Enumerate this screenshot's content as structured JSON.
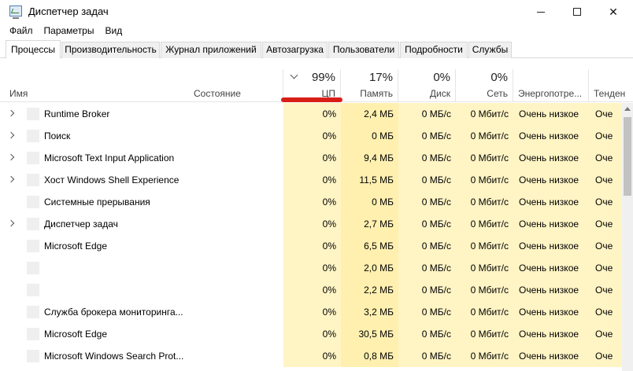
{
  "window": {
    "title": "Диспетчер задач",
    "minimize_label": "",
    "maximize_label": "",
    "close_label": "✕"
  },
  "menu": [
    "Файл",
    "Параметры",
    "Вид"
  ],
  "tabs": [
    {
      "label": "Процессы",
      "active": true
    },
    {
      "label": "Производительность"
    },
    {
      "label": "Журнал приложений"
    },
    {
      "label": "Автозагрузка"
    },
    {
      "label": "Пользователи"
    },
    {
      "label": "Подробности"
    },
    {
      "label": "Службы"
    }
  ],
  "columns": {
    "name": "Имя",
    "status": "Состояние",
    "cpu": {
      "label": "ЦП",
      "percent": "99%"
    },
    "memory": {
      "label": "Память",
      "percent": "17%"
    },
    "disk": {
      "label": "Диск",
      "percent": "0%"
    },
    "network": {
      "label": "Сеть",
      "percent": "0%"
    },
    "energy": "Энергопотре...",
    "trend": "Тенден"
  },
  "rows": [
    {
      "name": "Runtime Broker",
      "expandable": true,
      "cpu": "0%",
      "mem": "2,4 МБ",
      "disk": "0 МБ/с",
      "net": "0 Мбит/с",
      "energy": "Очень низкое",
      "trend": "Оче"
    },
    {
      "name": "Поиск",
      "expandable": true,
      "cpu": "0%",
      "mem": "0 МБ",
      "disk": "0 МБ/с",
      "net": "0 Мбит/с",
      "energy": "Очень низкое",
      "trend": "Оче"
    },
    {
      "name": "Microsoft Text Input Application",
      "expandable": true,
      "cpu": "0%",
      "mem": "9,4 МБ",
      "disk": "0 МБ/с",
      "net": "0 Мбит/с",
      "energy": "Очень низкое",
      "trend": "Оче"
    },
    {
      "name": "Хост Windows Shell Experience",
      "expandable": true,
      "cpu": "0%",
      "mem": "11,5 МБ",
      "disk": "0 МБ/с",
      "net": "0 Мбит/с",
      "energy": "Очень низкое",
      "trend": "Оче"
    },
    {
      "name": "Системные прерывания",
      "expandable": false,
      "cpu": "0%",
      "mem": "0 МБ",
      "disk": "0 МБ/с",
      "net": "0 Мбит/с",
      "energy": "Очень низкое",
      "trend": "Оче"
    },
    {
      "name": "Диспетчер задач",
      "expandable": true,
      "cpu": "0%",
      "mem": "2,7 МБ",
      "disk": "0 МБ/с",
      "net": "0 Мбит/с",
      "energy": "Очень низкое",
      "trend": "Оче"
    },
    {
      "name": "Microsoft Edge",
      "expandable": false,
      "cpu": "0%",
      "mem": "6,5 МБ",
      "disk": "0 МБ/с",
      "net": "0 Мбит/с",
      "energy": "Очень низкое",
      "trend": "Оче"
    },
    {
      "name": "",
      "expandable": false,
      "cpu": "0%",
      "mem": "2,0 МБ",
      "disk": "0 МБ/с",
      "net": "0 Мбит/с",
      "energy": "Очень низкое",
      "trend": "Оче"
    },
    {
      "name": "",
      "expandable": false,
      "cpu": "0%",
      "mem": "2,2 МБ",
      "disk": "0 МБ/с",
      "net": "0 Мбит/с",
      "energy": "Очень низкое",
      "trend": "Оче"
    },
    {
      "name": "Служба брокера мониторинга...",
      "expandable": false,
      "cpu": "0%",
      "mem": "3,2 МБ",
      "disk": "0 МБ/с",
      "net": "0 Мбит/с",
      "energy": "Очень низкое",
      "trend": "Оче"
    },
    {
      "name": "Microsoft Edge",
      "expandable": false,
      "cpu": "0%",
      "mem": "30,5 МБ",
      "disk": "0 МБ/с",
      "net": "0 Мбит/с",
      "energy": "Очень низкое",
      "trend": "Оче"
    },
    {
      "name": "Microsoft Windows Search Prot...",
      "expandable": false,
      "cpu": "0%",
      "mem": "0,8 МБ",
      "disk": "0 МБ/с",
      "net": "0 Мбит/с",
      "energy": "Очень низкое",
      "trend": "Оче"
    }
  ],
  "colors": {
    "accent_mark": "#d91e18",
    "cpu_highlight": "#fff4c4",
    "memory_highlight": "#fff0b0"
  }
}
